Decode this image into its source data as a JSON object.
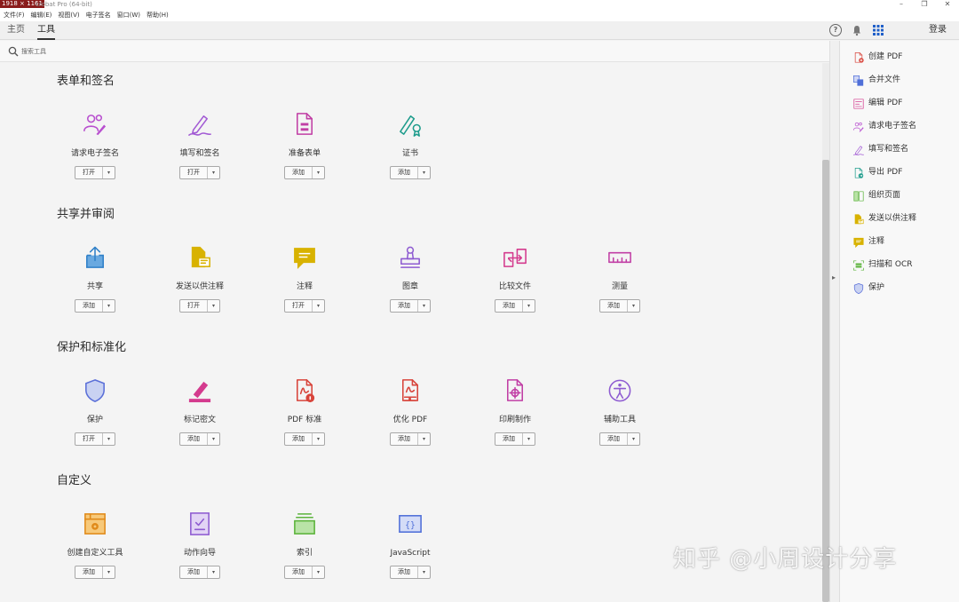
{
  "window": {
    "dimension_tag": "1918 × 1161",
    "title": "crobat Pro (64-bit)",
    "minimize": "–",
    "restore": "❐",
    "close": "✕"
  },
  "menu": [
    "文件(F)",
    "编辑(E)",
    "视图(V)",
    "电子签名",
    "窗口(W)",
    "帮助(H)"
  ],
  "tabs": {
    "home": "主页",
    "tools": "工具"
  },
  "header": {
    "help_glyph": "?",
    "bell_glyph": "🔔",
    "apps_glyph": "⋮⋮⋮",
    "sign_in": "登录"
  },
  "search": {
    "placeholder": "搜索工具",
    "value": ""
  },
  "sections": [
    {
      "title": "表单和签名",
      "tools": [
        {
          "label": "请求电子签名",
          "icon": "request-signature-icon",
          "button": "打开",
          "color": "#b84fcf"
        },
        {
          "label": "填写和签名",
          "icon": "fill-sign-icon",
          "button": "打开",
          "color": "#a25ad4"
        },
        {
          "label": "准备表单",
          "icon": "prepare-form-icon",
          "button": "添加",
          "color": "#c13fa5"
        },
        {
          "label": "证书",
          "icon": "certificate-icon",
          "button": "添加",
          "color": "#1e9c8c"
        }
      ]
    },
    {
      "title": "共享并审阅",
      "tools": [
        {
          "label": "共享",
          "icon": "share-icon",
          "button": "添加",
          "color": "#2f80c8"
        },
        {
          "label": "发送以供注释",
          "icon": "send-comment-icon",
          "button": "打开",
          "color": "#d8b200"
        },
        {
          "label": "注释",
          "icon": "comment-icon",
          "button": "打开",
          "color": "#d8b200"
        },
        {
          "label": "图章",
          "icon": "stamp-icon",
          "button": "添加",
          "color": "#8e5bd1"
        },
        {
          "label": "比较文件",
          "icon": "compare-icon",
          "button": "添加",
          "color": "#d43b8e"
        },
        {
          "label": "测量",
          "icon": "measure-icon",
          "button": "添加",
          "color": "#c13fa5"
        }
      ]
    },
    {
      "title": "保护和标准化",
      "tools": [
        {
          "label": "保护",
          "icon": "protect-shield-icon",
          "button": "打开",
          "color": "#5a6fd8"
        },
        {
          "label": "标记密文",
          "icon": "redact-icon",
          "button": "添加",
          "color": "#d43b8e"
        },
        {
          "label": "PDF 标准",
          "icon": "pdf-standards-icon",
          "button": "添加",
          "color": "#d8443b"
        },
        {
          "label": "优化 PDF",
          "icon": "optimize-pdf-icon",
          "button": "添加",
          "color": "#d8443b"
        },
        {
          "label": "印刷制作",
          "icon": "print-production-icon",
          "button": "添加",
          "color": "#c13fa5"
        },
        {
          "label": "辅助工具",
          "icon": "accessibility-icon",
          "button": "添加",
          "color": "#8e5bd1"
        }
      ]
    },
    {
      "title": "自定义",
      "tools": [
        {
          "label": "创建自定义工具",
          "icon": "create-custom-tool-icon",
          "button": "添加",
          "color": "#e08a1a"
        },
        {
          "label": "动作向导",
          "icon": "action-wizard-icon",
          "button": "添加",
          "color": "#8e5bd1"
        },
        {
          "label": "索引",
          "icon": "index-icon",
          "button": "添加",
          "color": "#5bb33b"
        },
        {
          "label": "JavaScript",
          "icon": "javascript-icon",
          "button": "添加",
          "color": "#4f6fd8"
        }
      ]
    }
  ],
  "right_pane": [
    {
      "label": "创建 PDF",
      "icon": "create-pdf-icon",
      "color": "#d8443b"
    },
    {
      "label": "合并文件",
      "icon": "combine-files-icon",
      "color": "#4f6fd8"
    },
    {
      "label": "编辑 PDF",
      "icon": "edit-pdf-icon",
      "color": "#d43b8e"
    },
    {
      "label": "请求电子签名",
      "icon": "request-signature-icon",
      "color": "#b84fcf"
    },
    {
      "label": "填写和签名",
      "icon": "fill-sign-icon",
      "color": "#a25ad4"
    },
    {
      "label": "导出 PDF",
      "icon": "export-pdf-icon",
      "color": "#1e9c8c"
    },
    {
      "label": "组织页面",
      "icon": "organize-pages-icon",
      "color": "#5bb33b"
    },
    {
      "label": "发送以供注释",
      "icon": "send-comment-icon",
      "color": "#d8b200"
    },
    {
      "label": "注释",
      "icon": "comment-icon",
      "color": "#d8b200"
    },
    {
      "label": "扫描和 OCR",
      "icon": "scan-ocr-icon",
      "color": "#5bb33b"
    },
    {
      "label": "保护",
      "icon": "protect-shield-icon",
      "color": "#5a6fd8"
    }
  ],
  "dropdown_glyph": "▾",
  "collapse_glyph": "▸",
  "watermark": "知乎 @小周设计分享"
}
